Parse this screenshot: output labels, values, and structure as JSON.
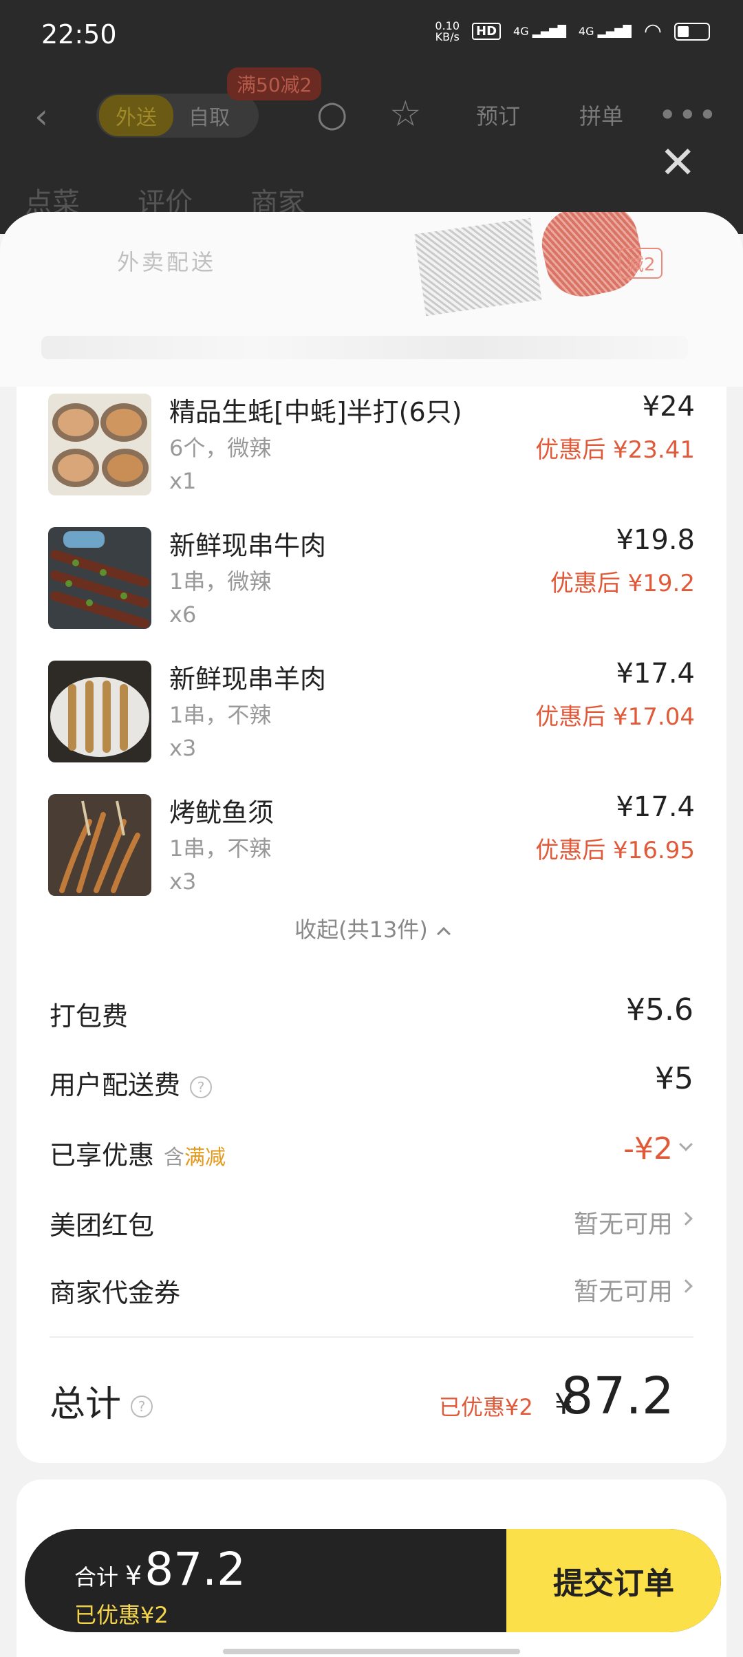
{
  "status": {
    "time": "22:50",
    "netspeed": "0.10\nKB/s",
    "hd": "HD",
    "sig1": "4G",
    "sig2": "4G"
  },
  "nav": {
    "seg_on": "外送",
    "seg_off": "自取",
    "promo": "满50减2",
    "link_reserve": "预订",
    "link_group": "拼单"
  },
  "subtabs": [
    "点菜",
    "评价",
    "商家"
  ],
  "delivery": {
    "title": "外卖配送",
    "tag": "减2"
  },
  "items": [
    {
      "name": "精品生蚝[中蚝]半打(6只)",
      "spec": "6个，微辣",
      "qty": "x1",
      "price": "¥24",
      "disc": "优惠后 ¥23.41"
    },
    {
      "name": "新鲜现串牛肉",
      "spec": "1串，微辣",
      "qty": "x6",
      "price": "¥19.8",
      "disc": "优惠后 ¥19.2"
    },
    {
      "name": "新鲜现串羊肉",
      "spec": "1串，不辣",
      "qty": "x3",
      "price": "¥17.4",
      "disc": "优惠后 ¥17.04"
    },
    {
      "name": "烤鱿鱼须",
      "spec": "1串，不辣",
      "qty": "x3",
      "price": "¥17.4",
      "disc": "优惠后 ¥16.95"
    }
  ],
  "collapse": "收起(共13件)",
  "fees": {
    "packing_label": "打包费",
    "packing_value": "¥5.6",
    "delivery_label": "用户配送费",
    "delivery_value": "¥5",
    "discount_label": "已享优惠",
    "discount_han": "含",
    "discount_type": "满减",
    "discount_value": "-¥2",
    "redpack_label": "美团红包",
    "redpack_value": "暂无可用",
    "voucher_label": "商家代金券",
    "voucher_value": "暂无可用"
  },
  "total": {
    "label": "总计",
    "saved": "已优惠¥2",
    "sym": "¥",
    "value": "87.2"
  },
  "bottom": {
    "heji": "合计",
    "sym": "¥",
    "amount": "87.2",
    "saved": "已优惠¥2",
    "submit": "提交订单"
  }
}
